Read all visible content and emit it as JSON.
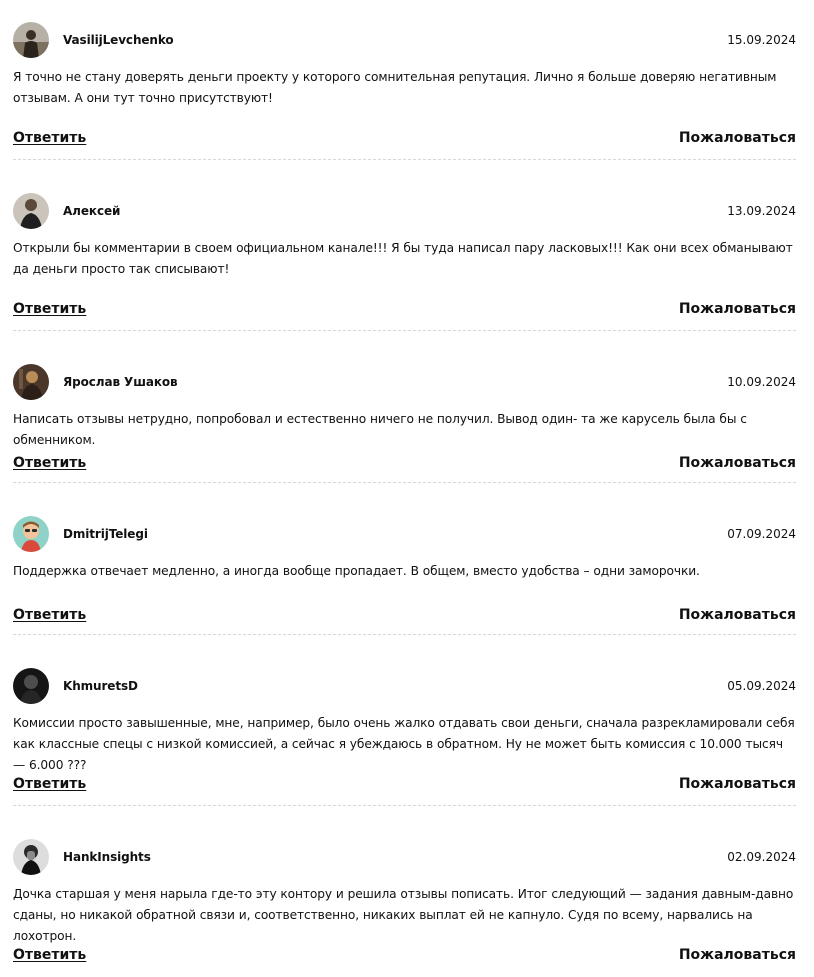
{
  "comments": [
    {
      "author": "VasilijLevchenko",
      "date": "15.09.2024",
      "text": "Я точно не стану доверять деньги проекту у которого сомнительная репутация. Лично я больше доверяю негативным отзывам. А они тут точно присутствуют!",
      "reply_label": "Ответить",
      "report_label": "Пожаловаться",
      "avatar": {
        "icon": "user-photo-icon",
        "background": "#b8b0a6",
        "foreground": "#3b2f25"
      }
    },
    {
      "author": "Алексей",
      "date": "13.09.2024",
      "text": "Открыли бы комментарии в своем официальном канале!!! Я бы туда написал пару ласковых!!! Как они всех обманывают да деньги просто так списывают!",
      "reply_label": "Ответить",
      "report_label": "Пожаловаться",
      "avatar": {
        "icon": "user-photo-icon",
        "background": "#c9c2b9",
        "foreground": "#1e1d1c"
      }
    },
    {
      "author": "Ярослав Ушаков",
      "date": "10.09.2024",
      "text": "Написать отзывы нетрудно, попробовал и естественно ничего не получил. Вывод один- та же карусель была бы с обменником.",
      "reply_label": "Ответить",
      "report_label": "Пожаловаться",
      "avatar": {
        "icon": "user-photo-icon",
        "background": "#4a3729",
        "foreground": "#c1955c"
      }
    },
    {
      "author": "DmitrijTelegi",
      "date": "07.09.2024",
      "text": "Поддержка отвечает медленно, а иногда вообще пропадает. В общем, вместо удобства – одни заморочки.",
      "reply_label": "Ответить",
      "report_label": "Пожаловаться",
      "avatar": {
        "icon": "cartoon-avatar-icon",
        "background": "#8fd3c8",
        "foreground": "#d94a3d"
      }
    },
    {
      "author": "KhmuretsD",
      "date": "05.09.2024",
      "text": "Комиссии просто завышенные, мне, например, было очень жалко отдавать свои деньги, сначала разрекламировали себя как классные спецы с низкой комиссией, а сейчас я убеждаюсь в обратном. Ну не может быть комиссия с 10.000 тысяч — 6.000 ???",
      "reply_label": "Ответить",
      "report_label": "Пожаловаться",
      "avatar": {
        "icon": "user-photo-icon",
        "background": "#1b1b1b",
        "foreground": "#5a5a5a"
      }
    },
    {
      "author": "HankInsights",
      "date": "02.09.2024",
      "text": "Дочка старшая у меня нарыла где-то эту контору и решила отзывы пописать. Итог следующий — задания давным-давно сданы, но никакой обратной связи и, соответственно, никаких выплат ей не капнуло. Судя по всему, нарвались на лохотрон.",
      "reply_label": "Ответить",
      "report_label": "Пожаловаться",
      "avatar": {
        "icon": "user-photo-icon",
        "background": "#d7d7d7",
        "foreground": "#1c1c1c"
      }
    }
  ]
}
